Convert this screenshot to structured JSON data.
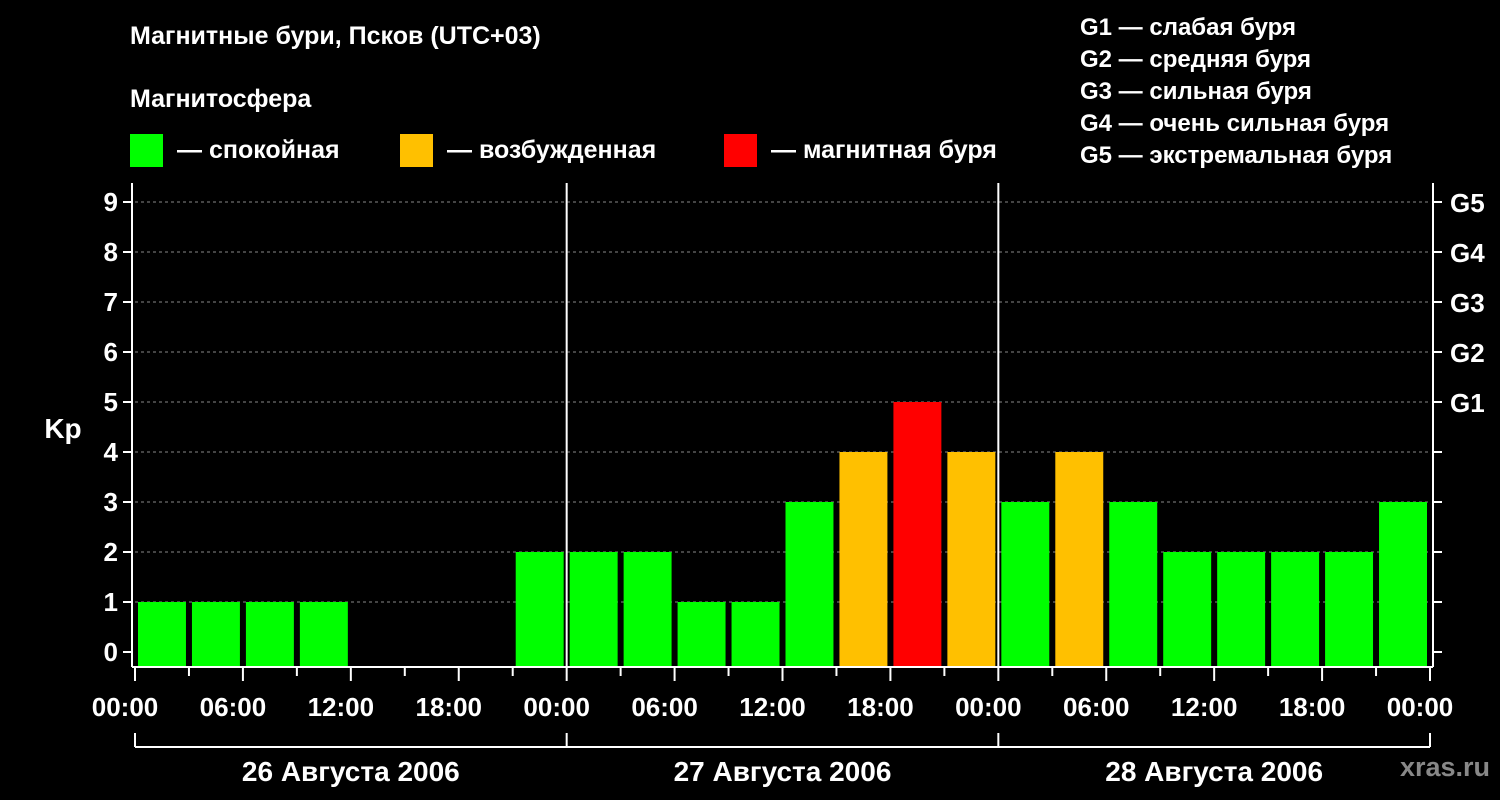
{
  "title": "Магнитные бури, Псков (UTC+03)",
  "subtitle": "Магнитосфера",
  "legend": [
    {
      "label": "— спокойная",
      "color": "#00ff00"
    },
    {
      "label": "— возбужденная",
      "color": "#ffc000"
    },
    {
      "label": "— магнитная буря",
      "color": "#ff0000"
    }
  ],
  "g_scale": [
    "G1 — слабая буря",
    "G2 — средняя буря",
    "G3 — сильная буря",
    "G4 — очень сильная буря",
    "G5 — экстремальная буря"
  ],
  "watermark": "xras.ru",
  "colors": {
    "quiet": "#00ff00",
    "active": "#ffc000",
    "storm": "#ff0000",
    "background": "#000000",
    "foreground": "#ffffff"
  },
  "chart_data": {
    "type": "bar",
    "ylabel": "Kp",
    "ylim": [
      0,
      9
    ],
    "yticks": [
      0,
      1,
      2,
      3,
      4,
      5,
      6,
      7,
      8,
      9
    ],
    "right_axis_labels": [
      {
        "kp": 5,
        "label": "G1"
      },
      {
        "kp": 6,
        "label": "G2"
      },
      {
        "kp": 7,
        "label": "G3"
      },
      {
        "kp": 8,
        "label": "G4"
      },
      {
        "kp": 9,
        "label": "G5"
      }
    ],
    "xtick_labels": [
      "00:00",
      "06:00",
      "12:00",
      "18:00",
      "00:00",
      "06:00",
      "12:00",
      "18:00",
      "00:00",
      "06:00",
      "12:00",
      "18:00",
      "00:00"
    ],
    "days": [
      "26 Августа 2006",
      "27 Августа 2006",
      "28 Августа 2006"
    ],
    "interval_hours": 3,
    "values": [
      1,
      1,
      1,
      1,
      0,
      0,
      0,
      2,
      2,
      2,
      1,
      1,
      3,
      4,
      5,
      4,
      3,
      4,
      3,
      2,
      2,
      2,
      2,
      3
    ],
    "categories": [
      "quiet",
      "quiet",
      "quiet",
      "quiet",
      "none",
      "none",
      "none",
      "quiet",
      "quiet",
      "quiet",
      "quiet",
      "quiet",
      "quiet",
      "active",
      "storm",
      "active",
      "quiet",
      "active",
      "quiet",
      "quiet",
      "quiet",
      "quiet",
      "quiet",
      "quiet"
    ],
    "grid": true
  }
}
